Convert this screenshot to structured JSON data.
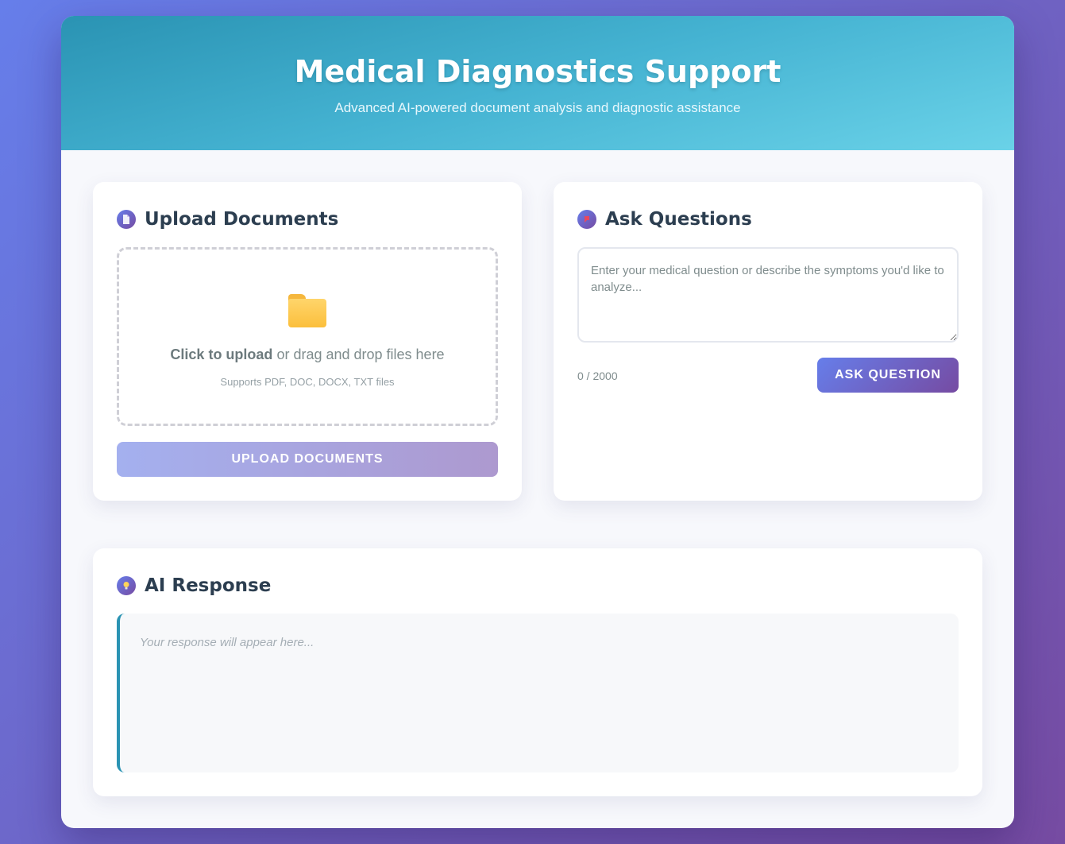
{
  "header": {
    "title": "Medical Diagnostics Support",
    "subtitle": "Advanced AI-powered document analysis and diagnostic assistance"
  },
  "upload": {
    "title": "Upload Documents",
    "icon": "document-icon",
    "drop_strong": "Click to upload",
    "drop_rest": " or drag and drop files here",
    "drop_sub": "Supports PDF, DOC, DOCX, TXT files",
    "button_label": "Upload Documents"
  },
  "ask": {
    "title": "Ask Questions",
    "icon": "chat-icon",
    "placeholder": "Enter your medical question or describe the symptoms you'd like to analyze...",
    "value": "",
    "char_count": "0 / 2000",
    "button_label": "Ask Question"
  },
  "response": {
    "title": "AI Response",
    "icon": "lightbulb-icon",
    "placeholder": "Your response will appear here..."
  },
  "colors": {
    "accent_start": "#667eea",
    "accent_end": "#764ba2",
    "header_teal": "#2a93b3",
    "header_cyan": "#6ad2e8"
  }
}
